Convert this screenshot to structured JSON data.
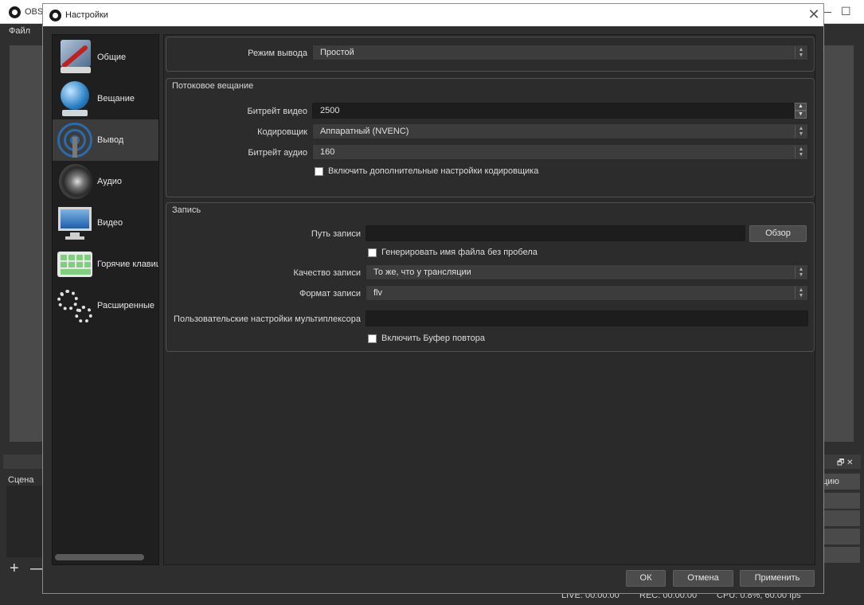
{
  "background": {
    "title": "OBS",
    "menu_file": "Файл",
    "scene_panel_title": "Сцена",
    "scene_add": "+",
    "scene_remove": "—",
    "right_button_1": "ацию",
    "status_live": "LIVE: 00:00:00",
    "status_rec": "REC: 00:00:00",
    "status_cpu": "CPU: 0.8%, 60.00 fps"
  },
  "dialog": {
    "title": "Настройки",
    "close_icon": "close-icon"
  },
  "sidebar": {
    "items": [
      {
        "label": "Общие",
        "icon": "general-icon"
      },
      {
        "label": "Вещание",
        "icon": "stream-icon"
      },
      {
        "label": "Вывод",
        "icon": "output-icon",
        "active": true
      },
      {
        "label": "Аудио",
        "icon": "audio-icon"
      },
      {
        "label": "Видео",
        "icon": "video-icon"
      },
      {
        "label": "Горячие клавиши",
        "icon": "hotkeys-icon"
      },
      {
        "label": "Расширенные",
        "icon": "advanced-icon"
      }
    ]
  },
  "output": {
    "mode_label": "Режим вывода",
    "mode_value": "Простой",
    "streaming": {
      "title": "Потоковое вещание",
      "video_bitrate_label": "Битрейт видео",
      "video_bitrate_value": "2500",
      "encoder_label": "Кодировщик",
      "encoder_value": "Аппаратный (NVENC)",
      "audio_bitrate_label": "Битрейт аудио",
      "audio_bitrate_value": "160",
      "advanced_encoder_label": "Включить дополнительные настройки кодировщика"
    },
    "recording": {
      "title": "Запись",
      "path_label": "Путь записи",
      "path_value": "",
      "browse_label": "Обзор",
      "no_space_label": "Генерировать имя файла без пробела",
      "quality_label": "Качество записи",
      "quality_value": "То же, что у трансляции",
      "format_label": "Формат записи",
      "format_value": "flv",
      "muxer_label": "Пользовательские настройки мультиплексора",
      "muxer_value": "",
      "replay_buffer_label": "Включить Буфер повтора"
    }
  },
  "footer": {
    "ok_label": "ОК",
    "cancel_label": "Отмена",
    "apply_label": "Применить"
  }
}
